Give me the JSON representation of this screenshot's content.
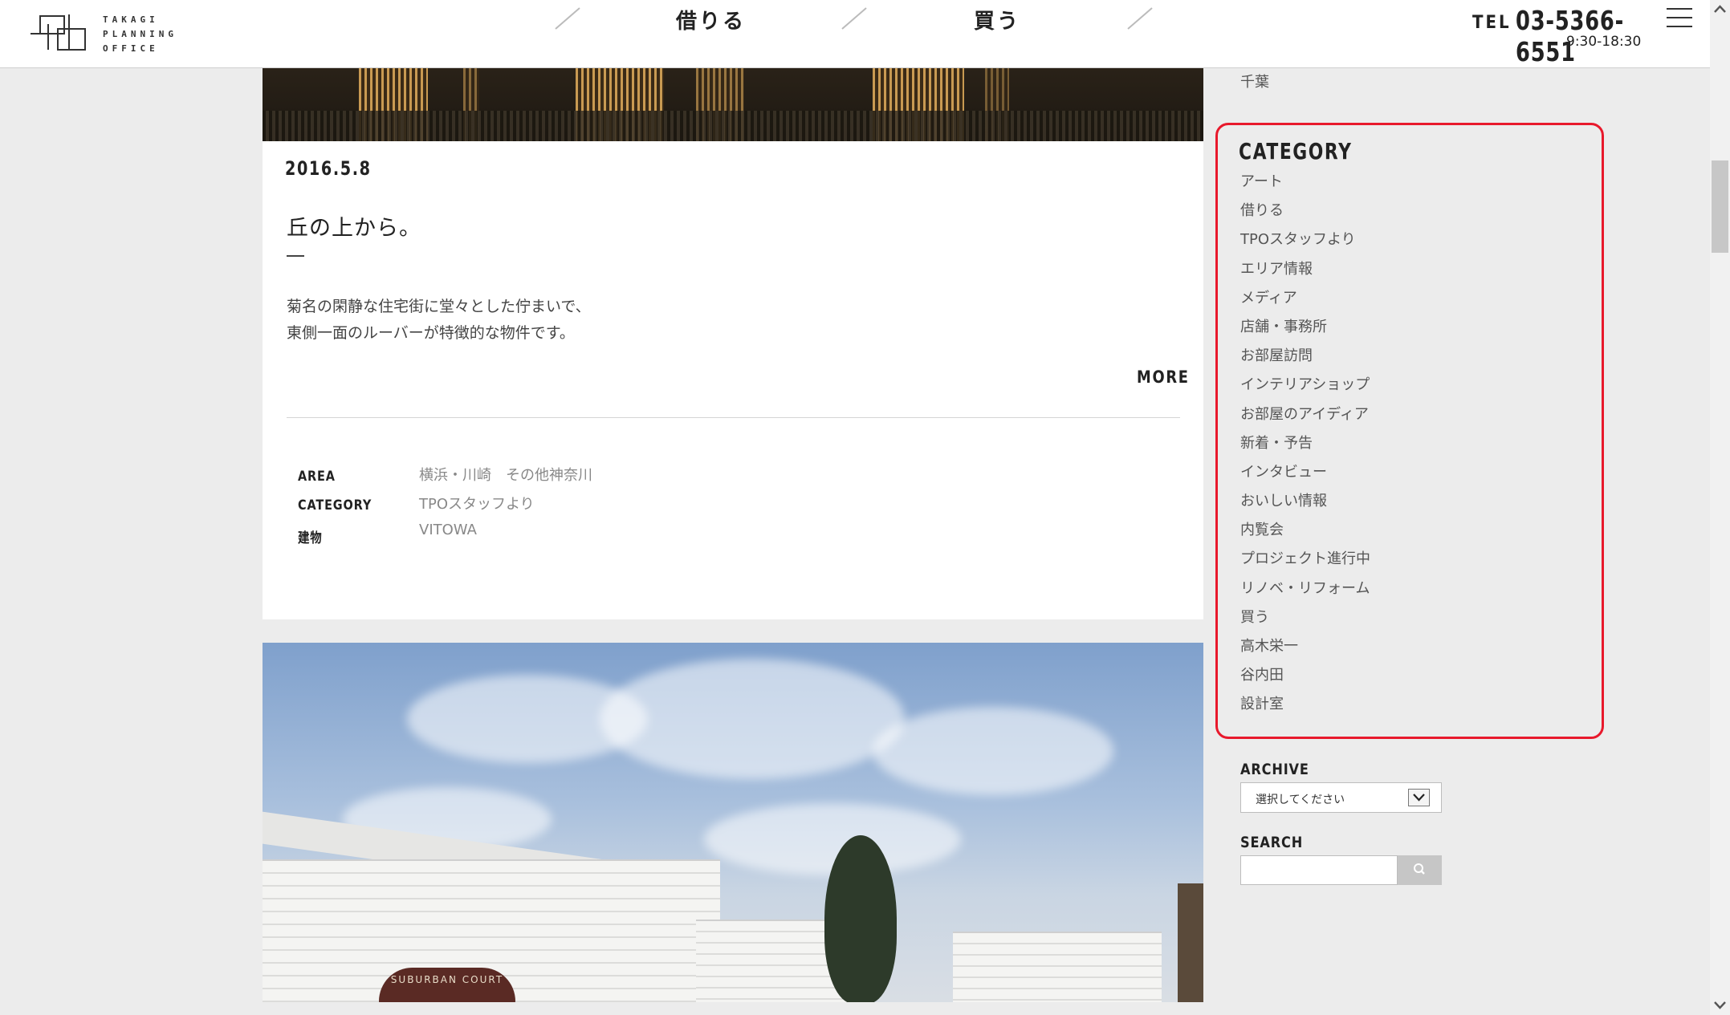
{
  "header": {
    "logo_text_lines": [
      "TAKAGI",
      "PLANNING",
      "OFFICE"
    ],
    "nav": [
      {
        "label": "借りる"
      },
      {
        "label": "買う"
      }
    ],
    "tel_label": "TEL",
    "tel_number": "03-5366-6551",
    "hours": "9:30-18:30"
  },
  "article": {
    "date": "2016.5.8",
    "title": "丘の上から。",
    "dash": "—",
    "excerpt_lines": [
      "菊名の閑静な住宅街に堂々とした佇まいで、",
      "東側一面のルーバーが特徴的な物件です。"
    ],
    "more_label": "MORE",
    "meta": [
      {
        "key": "AREA",
        "value": "横浜・川崎　その他神奈川"
      },
      {
        "key": "CATEGORY",
        "value": "TPOスタッフより"
      },
      {
        "key": "建物",
        "value": "VITOWA"
      }
    ]
  },
  "second_photo": {
    "sign_text_top": "SUBURBAN",
    "sign_text": "SUBURBAN COURT"
  },
  "sidebar": {
    "prev_item": "千葉",
    "category_heading": "CATEGORY",
    "categories": [
      "アート",
      "借りる",
      "TPOスタッフより",
      "エリア情報",
      "メディア",
      "店舗・事務所",
      "お部屋訪問",
      "インテリアショップ",
      "お部屋のアイディア",
      "新着・予告",
      "インタビュー",
      "おいしい情報",
      "内覧会",
      "プロジェクト進行中",
      "リノベ・リフォーム",
      "買う",
      "高木栄一",
      "谷内田",
      "設計室"
    ],
    "archive_heading": "ARCHIVE",
    "archive_selected": "選択してください",
    "search_heading": "SEARCH",
    "search_value": ""
  },
  "colors": {
    "highlight_border": "#e8192c",
    "page_background": "#ececec"
  }
}
